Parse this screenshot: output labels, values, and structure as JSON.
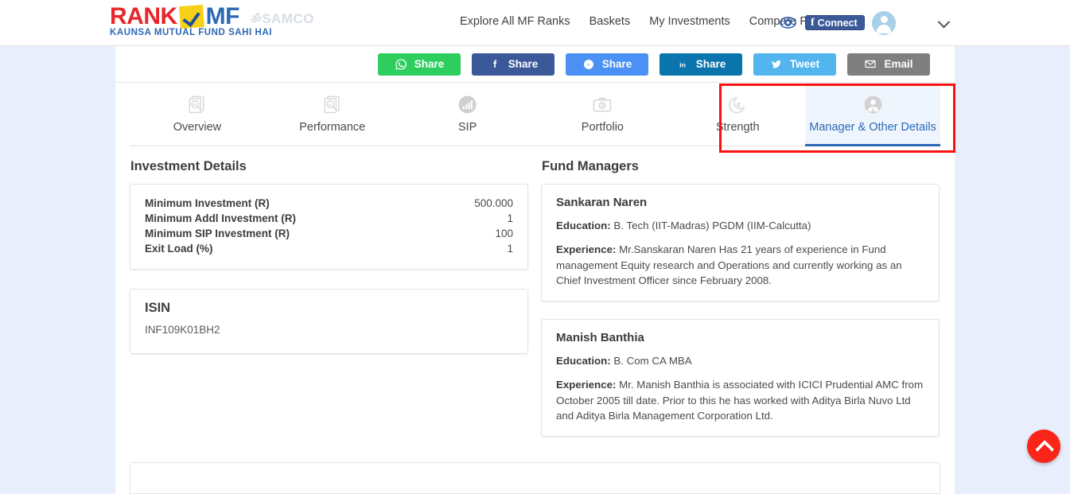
{
  "brand": {
    "rank": "RANK",
    "mf": "MF",
    "tagline": "KAUNSA MUTUAL FUND SAHI HAI",
    "partner": "SAMCO",
    "check_icon": "checkmark-icon",
    "logo_colors": {
      "rank": "#e8252a",
      "mf": "#2b68b5",
      "check_bg": "#f7d117"
    }
  },
  "nav": {
    "links": [
      {
        "label": "Explore All MF Ranks"
      },
      {
        "label": "Baskets"
      },
      {
        "label": "My Investments"
      },
      {
        "label": "Compare Funds"
      }
    ],
    "eye_icon": "eye-icon",
    "facebook_connect": {
      "label": "Connect",
      "icon": "facebook-f-icon",
      "color": "#3b5998"
    },
    "avatar_icon": "user-avatar-icon",
    "caret_icon": "chevron-down-icon"
  },
  "share": {
    "buttons": [
      {
        "label": "Share",
        "network": "whatsapp",
        "icon": "whatsapp-icon",
        "color": "#2dce5e"
      },
      {
        "label": "Share",
        "network": "facebook",
        "icon": "facebook-f-icon",
        "color": "#3b5998"
      },
      {
        "label": "Share",
        "network": "messenger",
        "icon": "messenger-icon",
        "color": "#4a90f5"
      },
      {
        "label": "Share",
        "network": "linkedin",
        "icon": "linkedin-in-icon",
        "color": "#0a74ad"
      },
      {
        "label": "Tweet",
        "network": "twitter",
        "icon": "twitter-bird-icon",
        "color": "#52b5ee"
      },
      {
        "label": "Email",
        "network": "email",
        "icon": "envelope-icon",
        "color": "#7f7f7f"
      }
    ]
  },
  "tabs": {
    "items": [
      {
        "label": "Overview",
        "icon": "document-search-icon",
        "active": false
      },
      {
        "label": "Performance",
        "icon": "document-search-icon",
        "active": false
      },
      {
        "label": "SIP",
        "icon": "bar-chart-circle-icon",
        "active": false
      },
      {
        "label": "Portfolio",
        "icon": "briefcase-icon",
        "active": false
      },
      {
        "label": "Strength",
        "icon": "moon-muscle-icon",
        "active": false
      },
      {
        "label": "Manager & Other Details",
        "icon": "manager-avatar-icon",
        "active": true
      }
    ],
    "highlight_color": "#fb1111",
    "active_color": "#2b68b5"
  },
  "investment_details": {
    "title": "Investment Details",
    "rows": [
      {
        "key": "Minimum Investment (R)",
        "value": "500.000"
      },
      {
        "key": "Minimum Addl Investment (R)",
        "value": "1"
      },
      {
        "key": "Minimum SIP Investment (R)",
        "value": "100"
      },
      {
        "key": "Exit Load (%)",
        "value": "1"
      }
    ]
  },
  "isin": {
    "title": "ISIN",
    "value": "INF109K01BH2"
  },
  "fund_managers": {
    "title": "Fund Managers",
    "managers": [
      {
        "name": "Sankaran Naren",
        "education_label": "Education:",
        "education": " B. Tech (IIT-Madras) PGDM (IIM-Calcutta)",
        "experience_label": "Experience:",
        "experience": " Mr.Sanskaran Naren Has 21 years of experience in Fund management Equity research and Operations and currently working as an Chief Investment Officer since February 2008."
      },
      {
        "name": "Manish Banthia",
        "education_label": "Education:",
        "education": " B. Com CA MBA",
        "experience_label": "Experience:",
        "experience": " Mr. Manish Banthia is associated with ICICI Prudential AMC from October 2005 till date. Prior to this he has worked with Aditya Birla Nuvo Ltd and Aditya Birla Management Corporation Ltd."
      }
    ]
  },
  "fab": {
    "icon": "chevron-up-icon",
    "color": "#fb2419",
    "label": ""
  }
}
